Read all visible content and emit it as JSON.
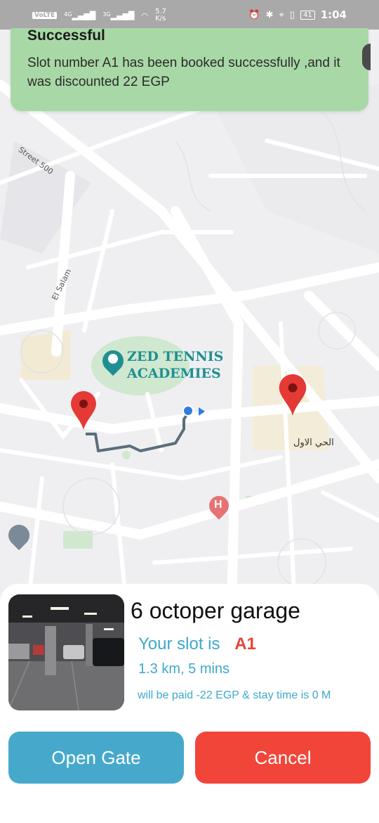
{
  "status_bar": {
    "network": "VoLTE",
    "signal_1": "4G",
    "signal_2": "3G",
    "speed": "5.7 K/s",
    "battery": "41",
    "time": "1:04"
  },
  "toast": {
    "title": "Successful",
    "message": "Slot number A1 has been booked successfully ,and it was discounted 22 EGP"
  },
  "map": {
    "labels": {
      "street_500": "Street 500",
      "el_salam": "El Salam",
      "zed_line1": "ZED TENNIS",
      "zed_line2": "ACADEMIES",
      "arabic_district": "الحي الاول",
      "hospital": "H"
    },
    "colors": {
      "background": "#efeff1",
      "road": "#ffffff",
      "route": "#5a6e7a",
      "pin": "#e53935",
      "user_dot": "#2f7de1",
      "zed_teal": "#1f8f91"
    }
  },
  "garage": {
    "name": "6 octoper garage",
    "slot_label": "Your slot is",
    "slot_id": "A1",
    "distance": "1.3 km, 5 mins",
    "payment_info": "will be paid -22 EGP & stay time is 0 M"
  },
  "actions": {
    "open_gate": "Open Gate",
    "cancel": "Cancel"
  }
}
